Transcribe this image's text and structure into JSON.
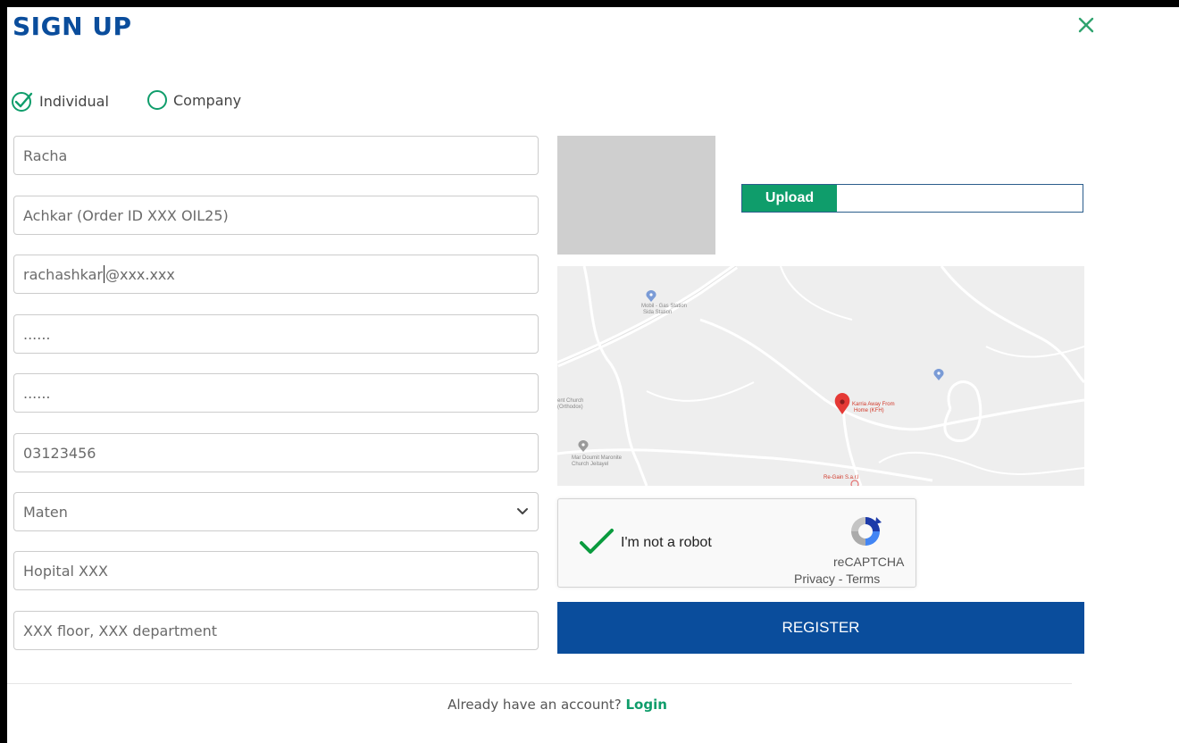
{
  "header": {
    "title": "SIGN UP",
    "close_icon": "close-icon"
  },
  "account_type": {
    "options": [
      {
        "label": "Individual",
        "selected": true
      },
      {
        "label": "Company",
        "selected": false
      }
    ]
  },
  "form": {
    "first_name": "Racha",
    "last_name": "Achkar (Order ID XXX OIL25)",
    "email_before_cursor": "rachashkar",
    "email_after_cursor": "@xxx.xxx",
    "password": "......",
    "confirm_password": "......",
    "phone": "03123456",
    "region_selected": "Maten",
    "organization": "Hopital XXX",
    "address_detail": "XXX floor, XXX department"
  },
  "upload": {
    "button_label": "Upload"
  },
  "map": {
    "labels": [
      "Mobil - Gas Station",
      "Sida Station",
      "ent Church",
      "(Orthodox)",
      "Mar Doumit Maronite",
      "Church Jeitayel",
      "Karria Away From",
      "Home (KFH)",
      "Re-Gain S.a.r.l"
    ]
  },
  "recaptcha": {
    "label": "I'm not a robot",
    "brand": "reCAPTCHA",
    "links": "Privacy - Terms",
    "checked": true
  },
  "register": {
    "label": "REGISTER"
  },
  "footer": {
    "text": "Already have an account?",
    "login_label": "Login"
  },
  "colors": {
    "brand_blue": "#0a4d9c",
    "accent_green": "#0f9d6b",
    "close_green": "#2fa36e"
  }
}
